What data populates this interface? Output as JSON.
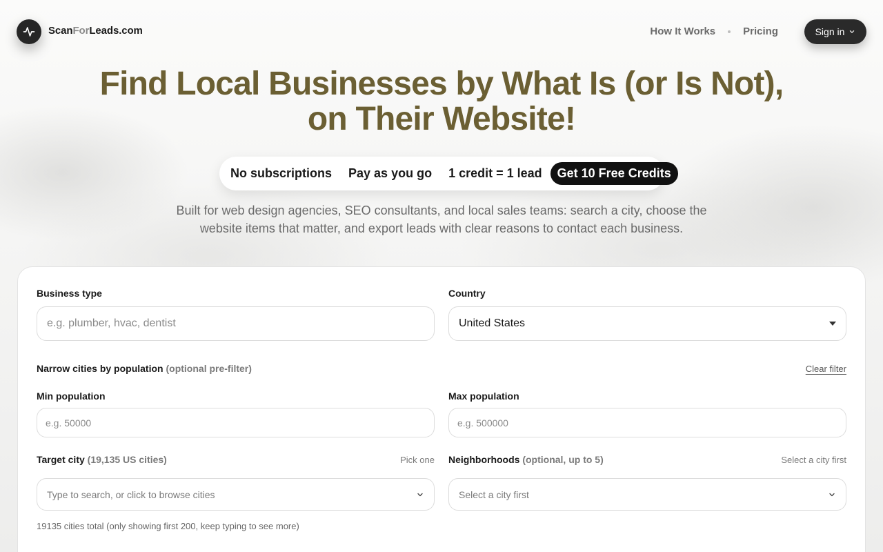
{
  "header": {
    "logo_part1": "Scan",
    "logo_part2": "For",
    "logo_part3": "Leads",
    "logo_part4": ".com",
    "logo_icon": "pulse-icon",
    "nav": [
      {
        "label": "How It Works"
      },
      {
        "label": "Pricing"
      }
    ],
    "signin_label": "Sign in",
    "signin_icon": "chevron-down-icon"
  },
  "hero": {
    "title_line1": "Find Local Businesses by What Is (or Is Not),",
    "title_line2": "on Their Website!",
    "title_color": "#6b5f33",
    "pills": [
      "No subscriptions",
      "Pay as you go",
      "1 credit = 1 lead"
    ],
    "cta_label": "Get 10 Free Credits",
    "subtext": "Built for web design agencies, SEO consultants, and local sales teams: search a city, choose the website items that matter, and export leads with clear reasons to contact each business."
  },
  "form": {
    "business_type": {
      "label": "Business type",
      "placeholder": "e.g. plumber, hvac, dentist",
      "value": ""
    },
    "country": {
      "label": "Country",
      "value": "United States"
    },
    "population_filter": {
      "label": "Narrow cities by population",
      "hint": "(optional pre-filter)",
      "clear_label": "Clear filter"
    },
    "min_population": {
      "label": "Min population",
      "placeholder": "e.g. 50000"
    },
    "max_population": {
      "label": "Max population",
      "placeholder": "e.g. 500000"
    },
    "target_city": {
      "label": "Target city",
      "hint": "(19,135 US cities)",
      "right_note": "Pick one",
      "placeholder": "Type to search, or click to browse cities"
    },
    "neighborhoods": {
      "label": "Neighborhoods",
      "hint": "(optional, up to 5)",
      "right_note": "Select a city first",
      "placeholder": "Select a city first"
    },
    "footnote": "19135 cities total (only showing first 200, keep typing to see more)"
  }
}
